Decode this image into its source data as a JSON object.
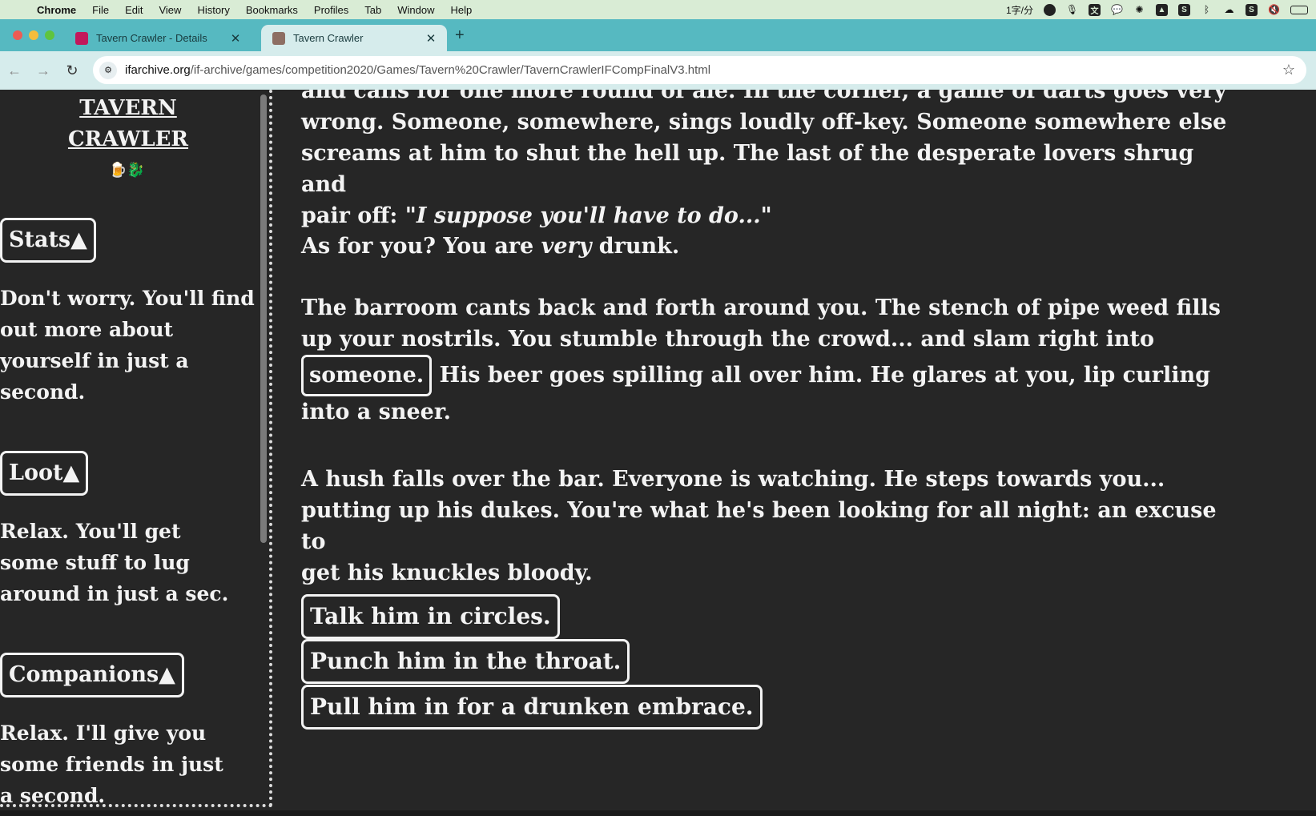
{
  "menubar": {
    "app": "Chrome",
    "items": [
      "File",
      "Edit",
      "View",
      "History",
      "Bookmarks",
      "Profiles",
      "Tab",
      "Window",
      "Help"
    ],
    "status": {
      "ime": "1字/分",
      "icons": [
        "face-icon",
        "microphone-icon",
        "translate-icon",
        "wechat-icon",
        "openai-icon",
        "drive-icon",
        "s-icon",
        "bluetooth-icon",
        "cloud-icon",
        "s-app-icon",
        "mute-icon",
        "battery-icon"
      ]
    }
  },
  "tabs": [
    {
      "title": "Tavern Crawler - Details",
      "active": false
    },
    {
      "title": "Tavern Crawler",
      "active": true
    }
  ],
  "address": {
    "host": "ifarchive.org",
    "path": "/if-archive/games/competition2020/Games/Tavern%20Crawler/TavernCrawlerIFCompFinalV3.html"
  },
  "sidebar": {
    "title_line1": "TAVERN",
    "title_line2": "CRAWLER",
    "title_emoji": "🍺🐉",
    "stats_button": "Stats▲",
    "stats_text": "Don't worry. You'll find out more about yourself in just a second.",
    "loot_button": "Loot▲",
    "loot_text": "Relax. You'll get some stuff to lug around in just a sec.",
    "companions_button": "Companions▲",
    "companions_text": "Relax. I'll give you some friends in just a second."
  },
  "story": {
    "p1_line1": "and calls for one more round of ale. In the corner, a game of darts goes very",
    "p1_line2": "wrong. Someone, somewhere, sings loudly off-key. Someone somewhere else",
    "p1_line3": "screams at him to shut the hell up. The last of the desperate lovers shrug and",
    "p1_line4_a": "pair off: \"",
    "p1_line4_em": "I suppose you'll have to do...",
    "p1_line4_b": "\"",
    "p2_a": "As for you? You are ",
    "p2_em": "very",
    "p2_b": " drunk.",
    "p3_line1": "The barroom cants back and forth around you. The stench of pipe weed fills",
    "p3_line2": "up your nostrils. You stumble through the crowd... and slam right into",
    "p3_link": "someone.",
    "p3_line3_rest": " His beer goes spilling all over him. He glares at you, lip curling",
    "p3_line4": "into a sneer.",
    "p4_line1": "A hush falls over the bar. Everyone is watching. He steps towards you...",
    "p4_line2": "putting up his dukes. You're what he's been looking for all night: an excuse to",
    "p4_line3": "get his knuckles bloody."
  },
  "choices": [
    "Talk him in circles.",
    "Punch him in the throat.",
    "Pull him in for a drunken embrace."
  ]
}
